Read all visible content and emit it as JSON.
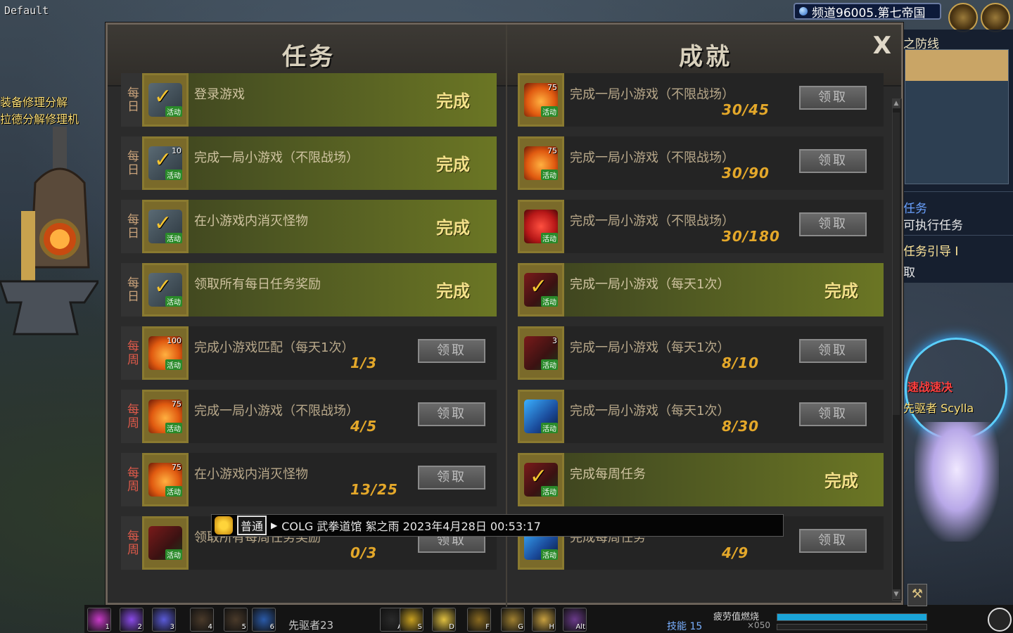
{
  "scene": {
    "profile_label": "Default",
    "npc_line1": "装备修理分解",
    "npc_line2": "拉德分解修理机",
    "channel": "频道96005.第七帝国",
    "side_title": "之防线",
    "side_task_head": "任务",
    "side_task_line": "可执行任务",
    "side_task_guide": "任务引导 I",
    "side_task_recv": "取",
    "char_title": "速战速决",
    "char_name": "先驱者 Scylla",
    "level_text": "先驱者23",
    "skill_points": "技能 15",
    "fatigue_label": "疲劳值燃烧",
    "fatigue_value": "×050",
    "skill_keys": [
      "1",
      "2",
      "3",
      "4",
      "5",
      "6",
      "A",
      "S",
      "D",
      "F",
      "G",
      "H",
      "Alt"
    ]
  },
  "dialog": {
    "left_title": "任务",
    "right_title": "成就",
    "close_label": "X",
    "done_label": "完成",
    "claim_label": "领取",
    "tasks": [
      {
        "tag": "每日",
        "type": "daily",
        "icon": "check-icon",
        "num": "",
        "title": "登录游戏",
        "done": true,
        "progress": ""
      },
      {
        "tag": "每日",
        "type": "daily",
        "icon": "check-icon",
        "num": "10",
        "title": "完成一局小游戏（不限战场）",
        "done": true,
        "progress": ""
      },
      {
        "tag": "每日",
        "type": "daily",
        "icon": "check-icon",
        "num": "",
        "title": "在小游戏内消灭怪物",
        "done": true,
        "progress": ""
      },
      {
        "tag": "每日",
        "type": "daily",
        "icon": "check-icon",
        "num": "",
        "title": "领取所有每日任务奖励",
        "done": true,
        "progress": ""
      },
      {
        "tag": "每周",
        "type": "weekly",
        "icon": "trophy-icon",
        "num": "100",
        "title": "完成小游戏匹配（每天1次）",
        "done": false,
        "progress": "1/3"
      },
      {
        "tag": "每周",
        "type": "weekly",
        "icon": "trophy-icon",
        "num": "75",
        "title": "完成一局小游戏（不限战场）",
        "done": false,
        "progress": "4/5"
      },
      {
        "tag": "每周",
        "type": "weekly",
        "icon": "trophy-icon",
        "num": "75",
        "title": "在小游戏内消灭怪物",
        "done": false,
        "progress": "13/25"
      },
      {
        "tag": "每周",
        "type": "weekly",
        "icon": "sword-icon",
        "num": "",
        "title": "领取所有每周任务奖励",
        "done": false,
        "progress": "0/3"
      }
    ],
    "achievements": [
      {
        "icon": "trophy-icon",
        "num": "75",
        "title": "完成一局小游戏（不限战场）",
        "done": false,
        "progress": "30/45"
      },
      {
        "icon": "trophy-icon",
        "num": "75",
        "title": "完成一局小游戏（不限战场）",
        "done": false,
        "progress": "30/90"
      },
      {
        "icon": "gift-icon",
        "num": "",
        "title": "完成一局小游戏（不限战场）",
        "done": false,
        "progress": "30/180"
      },
      {
        "icon": "sword-check-icon",
        "num": "",
        "title": "完成一局小游戏（每天1次）",
        "done": true,
        "progress": ""
      },
      {
        "icon": "sword-icon",
        "num": "3",
        "title": "完成一局小游戏（每天1次）",
        "done": false,
        "progress": "8/10"
      },
      {
        "icon": "blue-sword-icon",
        "num": "",
        "title": "完成一局小游戏（每天1次）",
        "done": false,
        "progress": "8/30"
      },
      {
        "icon": "sword-check-icon",
        "num": "",
        "title": "完成每周任务",
        "done": true,
        "progress": ""
      },
      {
        "icon": "blue-sword-icon",
        "num": "",
        "title": "完成每周任务",
        "done": false,
        "progress": "4/9"
      }
    ],
    "badge_text": "活动"
  },
  "chat": {
    "channel": "普通",
    "message": "COLG 武拳道馆 絮之雨 2023年4月28日 00:53:17"
  },
  "colors": {
    "done_row": "#6b7624",
    "daily_tag": "#c9a27a",
    "weekly_tag": "#e05a4a",
    "progress": "#e4a82a",
    "done_text": "#f3e08a"
  }
}
